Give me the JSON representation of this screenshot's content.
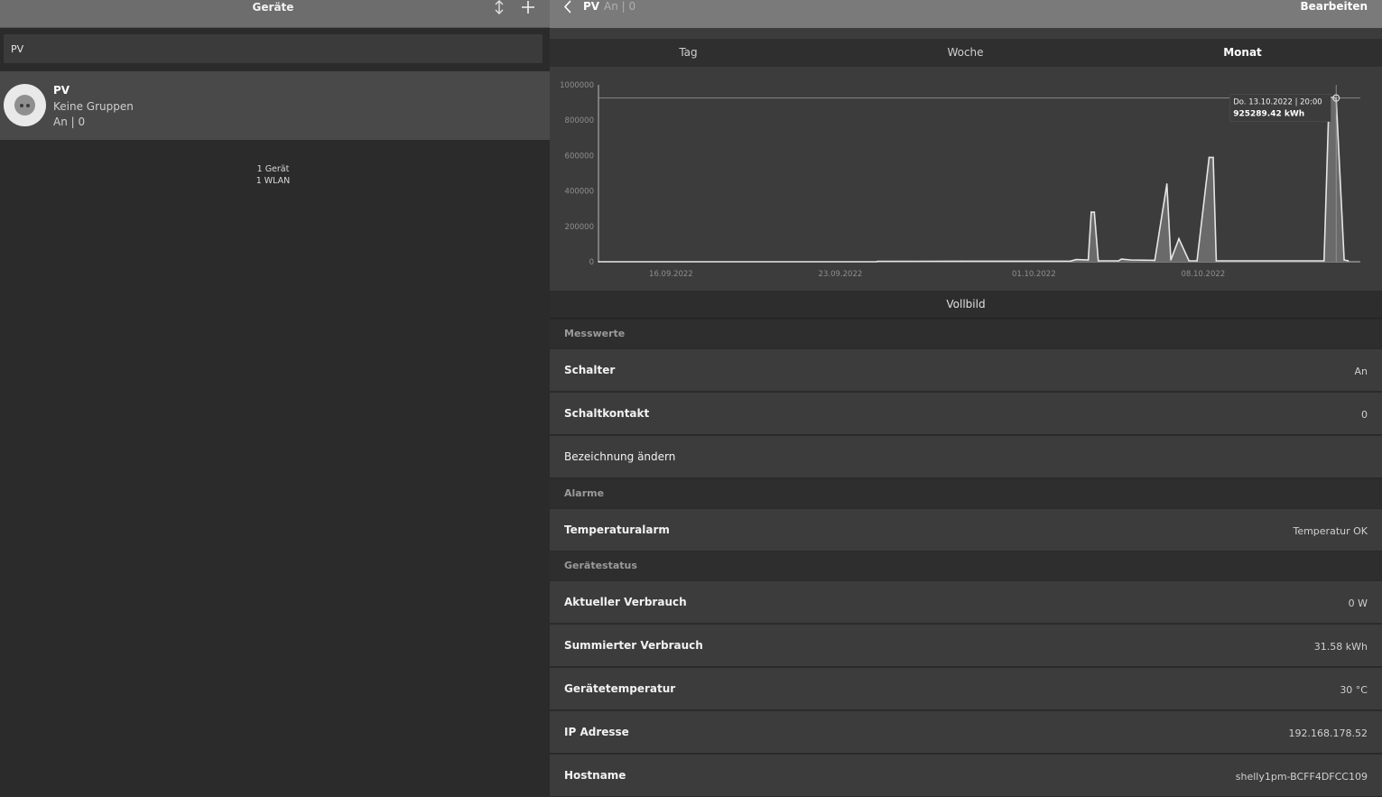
{
  "left": {
    "title": "Geräte",
    "search_value": "PV",
    "device": {
      "name": "PV",
      "groups": "Keine Gruppen",
      "state": "An | 0"
    },
    "summary": [
      "1 Gerät",
      "1 WLAN"
    ]
  },
  "header": {
    "title": "PV",
    "subtitle": "An | 0",
    "edit_label": "Bearbeiten"
  },
  "tabs": [
    {
      "label": "Tag",
      "active": false
    },
    {
      "label": "Woche",
      "active": false
    },
    {
      "label": "Monat",
      "active": true
    }
  ],
  "chart_data": {
    "type": "area",
    "x_ticks": [
      "16.09.2022",
      "23.09.2022",
      "01.10.2022",
      "08.10.2022"
    ],
    "y_ticks": [
      "0",
      "200000",
      "400000",
      "600000",
      "800000",
      "1000000"
    ],
    "ylim": [
      0,
      1000000
    ],
    "xlim": [
      "2022-09-13",
      "2022-10-14"
    ],
    "points": [
      [
        "2022-09-13T00:00",
        0
      ],
      [
        "2022-09-24T12:00",
        0
      ],
      [
        "2022-09-24T13:00",
        2000
      ],
      [
        "2022-09-28T00:00",
        3000
      ],
      [
        "2022-10-02T12:00",
        3000
      ],
      [
        "2022-10-02T18:00",
        12000
      ],
      [
        "2022-10-03T06:00",
        10000
      ],
      [
        "2022-10-03T09:00",
        280000
      ],
      [
        "2022-10-03T12:00",
        280000
      ],
      [
        "2022-10-03T16:00",
        5000
      ],
      [
        "2022-10-04T12:00",
        5000
      ],
      [
        "2022-10-04T15:00",
        15000
      ],
      [
        "2022-10-05T00:00",
        10000
      ],
      [
        "2022-10-06T00:00",
        8000
      ],
      [
        "2022-10-06T12:00",
        440000
      ],
      [
        "2022-10-06T16:00",
        10000
      ],
      [
        "2022-10-07T00:00",
        130000
      ],
      [
        "2022-10-07T10:00",
        5000
      ],
      [
        "2022-10-07T18:00",
        5000
      ],
      [
        "2022-10-08T06:00",
        590000
      ],
      [
        "2022-10-08T10:00",
        590000
      ],
      [
        "2022-10-08T13:00",
        5000
      ],
      [
        "2022-10-13T00:00",
        5000
      ],
      [
        "2022-10-13T05:00",
        930000
      ],
      [
        "2022-10-13T12:00",
        925289
      ],
      [
        "2022-10-13T20:00",
        10000
      ],
      [
        "2022-10-14T00:00",
        5000
      ]
    ],
    "tooltip": {
      "date": "Do. 13.10.2022 | 20:00",
      "value": "925289.42 kWh"
    },
    "grid": false,
    "line_color": "#e6e6e6",
    "fill_color": "#6a6a6a"
  },
  "fullscreen_label": "Vollbild",
  "sections": [
    {
      "title": "Messwerte",
      "rows": [
        {
          "label": "Schalter",
          "value": "An",
          "bold": true
        },
        {
          "label": "Schaltkontakt",
          "value": "0",
          "bold": true
        },
        {
          "label": "Bezeichnung ändern",
          "value": "",
          "bold": false
        }
      ]
    },
    {
      "title": "Alarme",
      "rows": [
        {
          "label": "Temperaturalarm",
          "value": "Temperatur OK",
          "bold": true
        }
      ]
    },
    {
      "title": "Gerätestatus",
      "rows": [
        {
          "label": "Aktueller Verbrauch",
          "value": "0 W",
          "bold": true
        },
        {
          "label": "Summierter Verbrauch",
          "value": "31.58 kWh",
          "bold": true
        },
        {
          "label": "Gerätetemperatur",
          "value": "30 °C",
          "bold": true
        },
        {
          "label": "IP Adresse",
          "value": "192.168.178.52",
          "bold": true
        },
        {
          "label": "Hostname",
          "value": "shelly1pm-BCFF4DFCC109",
          "bold": true
        }
      ]
    }
  ]
}
